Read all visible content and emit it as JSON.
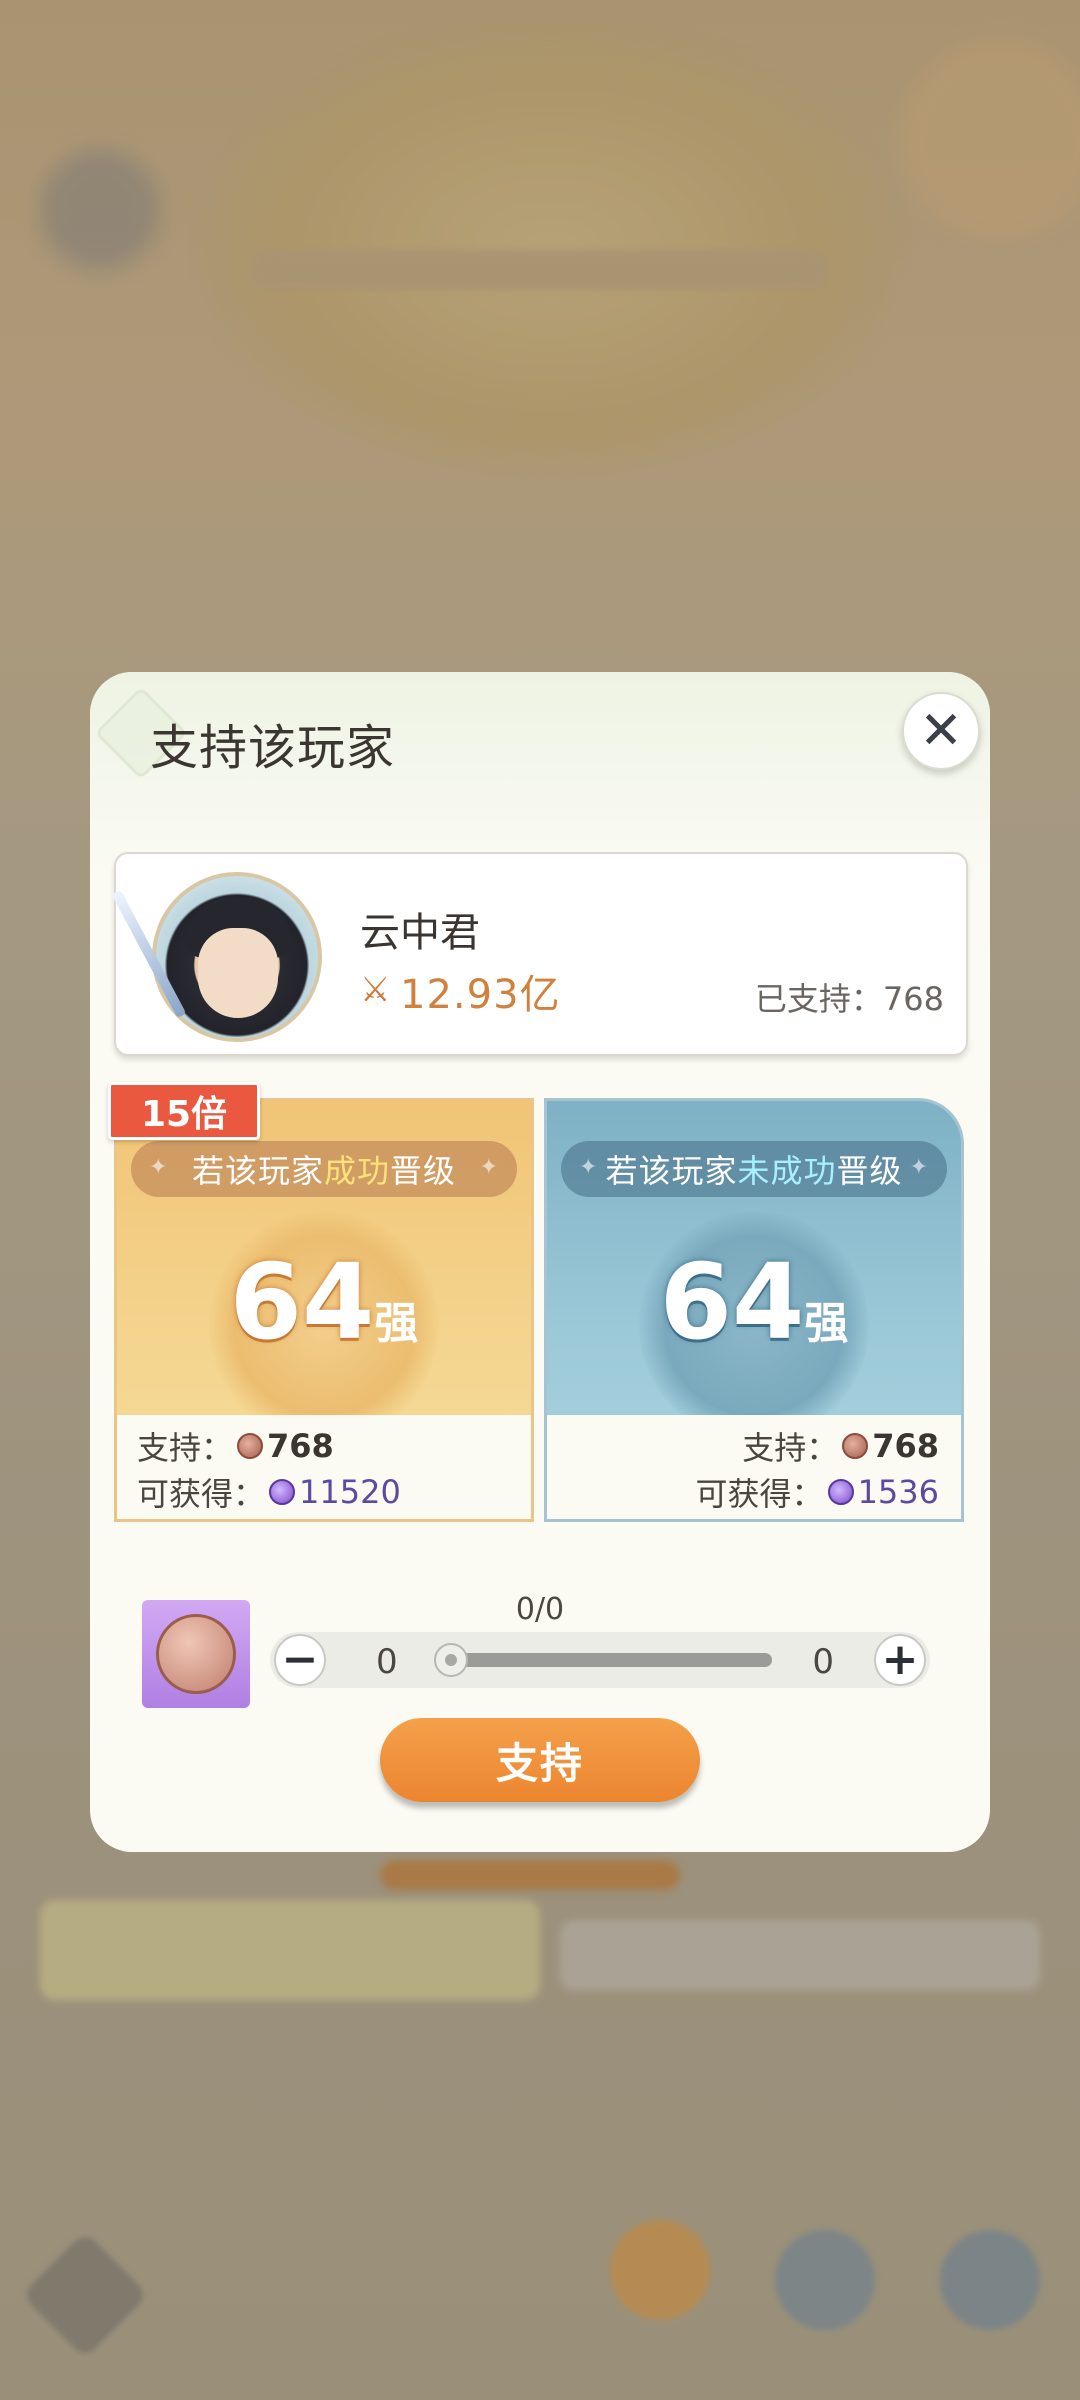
{
  "dialog": {
    "title": "支持该玩家",
    "close_icon": "close-icon"
  },
  "player": {
    "name": "云中君",
    "power": "12.93亿",
    "supported_label": "已支持：768"
  },
  "multiplier_badge": "15倍",
  "win_box": {
    "cond_prefix": "若该玩家",
    "cond_highlight": "成功",
    "cond_suffix": "晋级",
    "rank_num": "64",
    "rank_unit": "强",
    "support_label": "支持：",
    "support_value": "768",
    "reward_label": "可获得：",
    "reward_value": "11520"
  },
  "lose_box": {
    "cond_prefix": "若该玩家",
    "cond_highlight": "未成功",
    "cond_suffix": "晋级",
    "rank_num": "64",
    "rank_unit": "强",
    "support_label": "支持：",
    "support_value": "768",
    "reward_label": "可获得：",
    "reward_value": "1536"
  },
  "counter": {
    "label": "0/0",
    "left_value": "0",
    "right_value": "0",
    "slider_value": 0
  },
  "support_button": "支持",
  "colors": {
    "win_accent": "#f1c476",
    "lose_accent": "#7eb1c5",
    "button": "#ec8530",
    "badge": "#e9583f"
  }
}
